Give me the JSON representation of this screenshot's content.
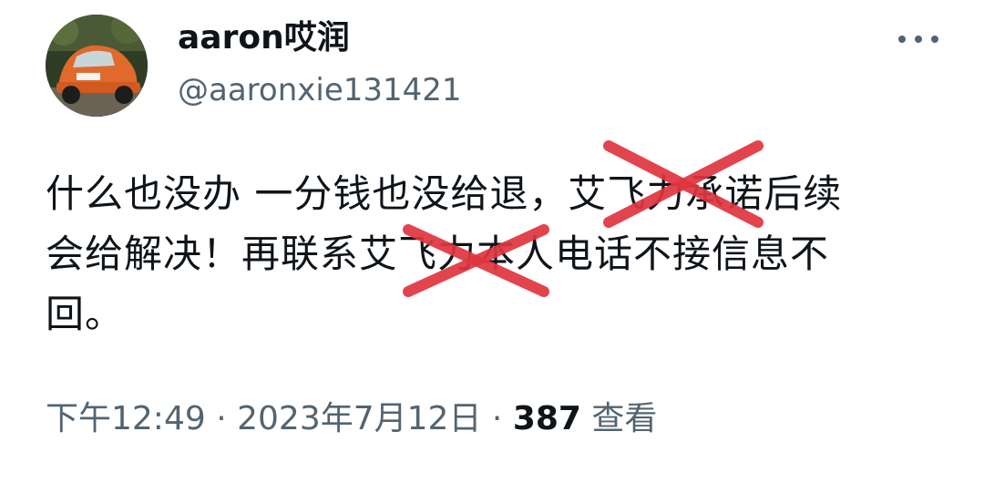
{
  "author": {
    "display_name": "aaron哎润",
    "handle": "@aaronxie131421"
  },
  "tweet": {
    "lines": [
      "什么也没办 一分钱也没给退，艾飞力承诺后续",
      "会给解决！再联系艾飞力本人电话不接信息不",
      "回。"
    ]
  },
  "meta": {
    "time": "下午12:49",
    "separator": "·",
    "date": "2023年7月12日",
    "views_count": "387",
    "views_label": "查看"
  },
  "icons": {
    "more": "more-horizontal-icon",
    "redaction_mark": "red-x-mark"
  },
  "colors": {
    "text": "#0f1419",
    "secondary": "#536471",
    "redaction": "#e0353f"
  }
}
